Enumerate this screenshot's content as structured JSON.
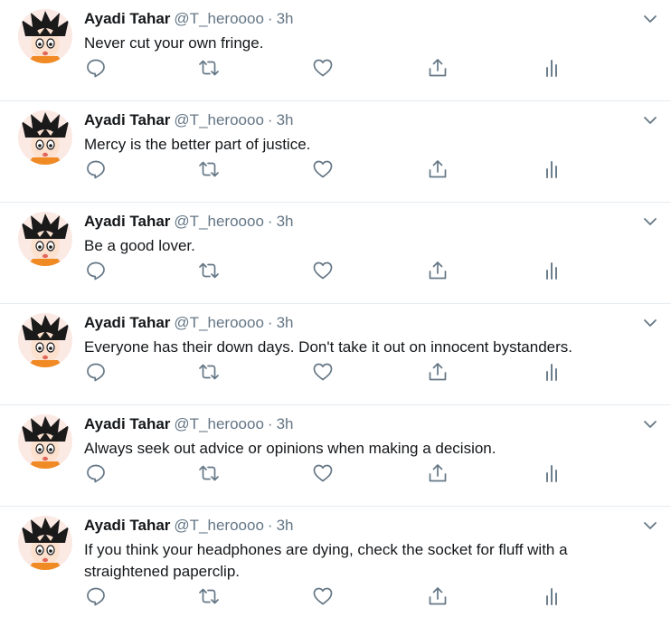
{
  "tweets": [
    {
      "name": "Ayadi Tahar",
      "handle": "@T_heroooo",
      "separator": "·",
      "time": "3h",
      "text": "Never cut your own fringe."
    },
    {
      "name": "Ayadi Tahar",
      "handle": "@T_heroooo",
      "separator": "·",
      "time": "3h",
      "text": "Mercy is the better part of justice."
    },
    {
      "name": "Ayadi Tahar",
      "handle": "@T_heroooo",
      "separator": "·",
      "time": "3h",
      "text": "Be a good lover."
    },
    {
      "name": "Ayadi Tahar",
      "handle": "@T_heroooo",
      "separator": "·",
      "time": "3h",
      "text": "Everyone has their down days. Don't take it out on innocent bystanders."
    },
    {
      "name": "Ayadi Tahar",
      "handle": "@T_heroooo",
      "separator": "·",
      "time": "3h",
      "text": "Always seek out advice or opinions when making a decision."
    },
    {
      "name": "Ayadi Tahar",
      "handle": "@T_heroooo",
      "separator": "·",
      "time": "3h",
      "text": "If you think your headphones are dying, check the socket for fluff with a straightened paperclip."
    }
  ],
  "icons": {
    "reply": "reply-icon",
    "retweet": "retweet-icon",
    "like": "heart-icon",
    "share": "share-icon",
    "analytics": "analytics-icon",
    "menu": "chevron-down-icon",
    "avatar": "goku-avatar"
  },
  "colors": {
    "icon": "#657786",
    "border": "#e6ecf0",
    "name": "#14171a",
    "muted": "#657786"
  }
}
